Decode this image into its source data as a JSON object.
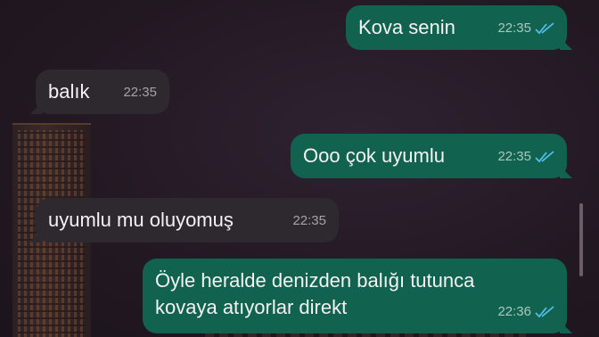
{
  "messages": [
    {
      "text": "Kova senin",
      "time": "22:35",
      "direction": "outgoing",
      "status": "read-double-check"
    },
    {
      "text": "balık",
      "time": "22:35",
      "direction": "incoming"
    },
    {
      "text": "Ooo çok uyumlu",
      "time": "22:35",
      "direction": "outgoing",
      "status": "read-double-check"
    },
    {
      "text": "uyumlu mu oluyomuş",
      "time": "22:35",
      "direction": "incoming"
    },
    {
      "text": "Öyle heralde denizden balığı tutunca kovaya atıyorlar direkt",
      "time": "22:36",
      "direction": "outgoing",
      "status": "read-double-check"
    }
  ],
  "colors": {
    "outgoing_bubble": "#11624e",
    "incoming_bubble": "#2d292f",
    "read_ticks": "#53bdeb",
    "background": "#241a22"
  },
  "icons": {
    "read_receipt": "double-check-icon"
  }
}
